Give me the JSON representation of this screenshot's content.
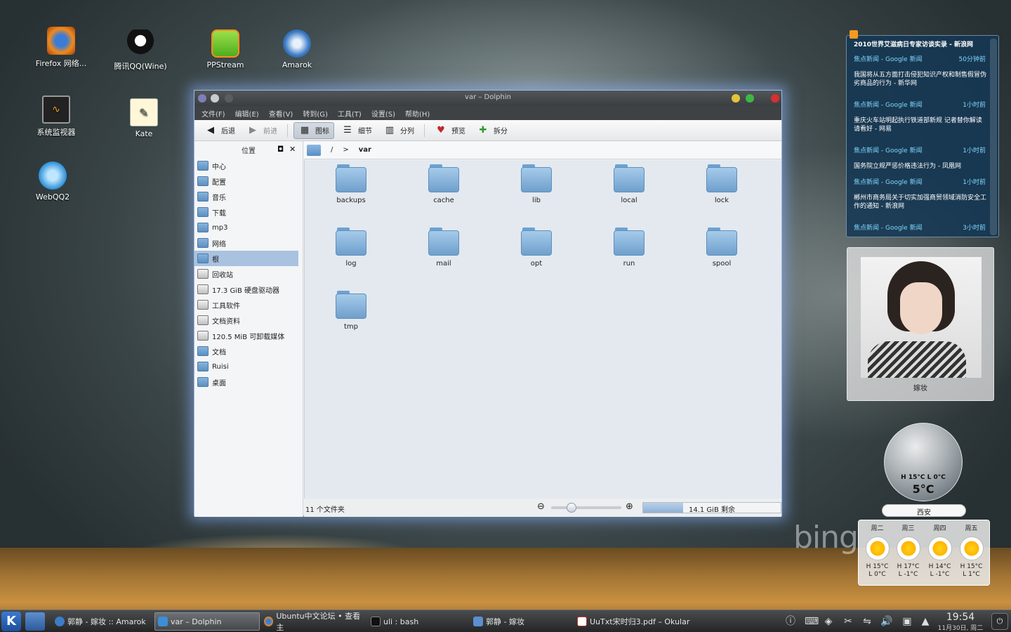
{
  "desktop": {
    "icons": [
      {
        "label": "Firefox 网络..."
      },
      {
        "label": "腾讯QQ(Wine)"
      },
      {
        "label": "PPStream"
      },
      {
        "label": "Amarok"
      },
      {
        "label": "系统监视器"
      },
      {
        "label": "Kate"
      },
      {
        "label": "WebQQ2"
      }
    ],
    "wallpaper_logo": "bing"
  },
  "window": {
    "title": "var – Dolphin",
    "menu": [
      "文件(F)",
      "编辑(E)",
      "查看(V)",
      "转到(G)",
      "工具(T)",
      "设置(S)",
      "帮助(H)"
    ],
    "toolbar": {
      "back": "后退",
      "forward": "前进",
      "icons": "图标",
      "details": "细节",
      "columns": "分列",
      "preview": "预览",
      "split": "拆分"
    },
    "places": {
      "title": "位置",
      "items": [
        {
          "label": "中心",
          "type": "folder"
        },
        {
          "label": "配置",
          "type": "folder"
        },
        {
          "label": "音乐",
          "type": "folder"
        },
        {
          "label": "下载",
          "type": "folder"
        },
        {
          "label": "mp3",
          "type": "folder"
        },
        {
          "label": "网络",
          "type": "network"
        },
        {
          "label": "根",
          "type": "folder"
        },
        {
          "label": "回收站",
          "type": "trash"
        },
        {
          "label": "17.3 GiB 硬盘驱动器",
          "type": "drive"
        },
        {
          "label": "工具软件",
          "type": "drive"
        },
        {
          "label": "文档资料",
          "type": "drive"
        },
        {
          "label": "120.5 MiB 可卸载媒体",
          "type": "drive"
        },
        {
          "label": "文档",
          "type": "folder"
        },
        {
          "label": "Ruisi",
          "type": "folder"
        },
        {
          "label": "桌面",
          "type": "folder"
        }
      ],
      "selected_index": 6
    },
    "breadcrumb": {
      "root": "/",
      "separator": ">",
      "current": "var"
    },
    "folders": [
      "backups",
      "cache",
      "lib",
      "local",
      "lock",
      "log",
      "mail",
      "opt",
      "run",
      "spool",
      "tmp"
    ],
    "status": {
      "count": "11 个文件夹",
      "free_space": "14.1 GiB 剩余",
      "used_fraction": 0.29,
      "zoom_fraction": 0.22
    }
  },
  "news": {
    "feed_title": "2010世界艾滋病日专家访谈实录 - 新浪网",
    "entries": [
      {
        "source": "焦点新闻 - Google 新闻",
        "time": "50分钟前",
        "headline": "我国将从五方面打击侵犯知识产权和制售假冒伪劣商品的行为 - 新华网"
      },
      {
        "source": "焦点新闻 - Google 新闻",
        "time": "1小时前",
        "headline": "重庆火车站明起执行铁道部新规 记者替你解读请看好 - 网易"
      },
      {
        "source": "焦点新闻 - Google 新闻",
        "time": "1小时前",
        "headline": "国务院立规严惩价格违法行为 - 凤凰网"
      },
      {
        "source": "焦点新闻 - Google 新闻",
        "time": "1小时前",
        "headline": "郴州市商务局关于切实加强商贸领域消防安全工作的通知 - 新浪网"
      },
      {
        "source": "焦点新闻 - Google 新闻",
        "time": "3小时前",
        "headline": ""
      }
    ]
  },
  "photo": {
    "caption": "嫁妆"
  },
  "weather": {
    "high": "H 15°C",
    "low": "L 0°C",
    "current": "5°C",
    "city": "西安",
    "forecast": [
      {
        "day": "周二",
        "hi": "H 15°C",
        "lo": "L 0°C"
      },
      {
        "day": "周三",
        "hi": "H 17°C",
        "lo": "L -1°C"
      },
      {
        "day": "周四",
        "hi": "H 14°C",
        "lo": "L -1°C"
      },
      {
        "day": "周五",
        "hi": "H 15°C",
        "lo": "L 1°C"
      }
    ]
  },
  "taskbar": {
    "tasks": [
      {
        "label": "郭静 - 嫁妆 :: Amarok"
      },
      {
        "label": "var – Dolphin"
      },
      {
        "label": "Ubuntu中文论坛 • 查看主"
      },
      {
        "label": "uli : bash"
      },
      {
        "label": "郭静 - 嫁妆"
      },
      {
        "label": "UuTxt宋时归3.pdf – Okular"
      }
    ],
    "clock_time": "19:54",
    "clock_date": "11月30日, 周二"
  }
}
